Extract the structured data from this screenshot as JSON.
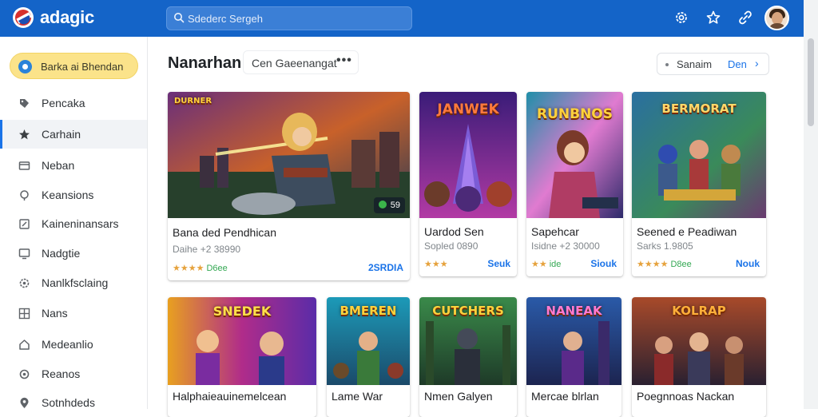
{
  "app": {
    "title": "adagic"
  },
  "search": {
    "placeholder": "Sdederc Sergeh"
  },
  "header_icons": [
    "settings-cog-icon",
    "star-icon",
    "link-icon"
  ],
  "sidebar": {
    "primary_button": "Barka ai Bhendan",
    "items": [
      {
        "label": "Pencaka",
        "icon": "tag-icon"
      },
      {
        "label": "Carhain",
        "icon": "star-icon"
      },
      {
        "label": "Neban",
        "icon": "card-icon"
      },
      {
        "label": "Keansions",
        "icon": "pin-icon"
      },
      {
        "label": "Kaineninansars",
        "icon": "edit-icon"
      },
      {
        "label": "Nadgtie",
        "icon": "monitor-icon"
      },
      {
        "label": "Nanlkfsclaing",
        "icon": "settings-icon"
      },
      {
        "label": "Nans",
        "icon": "grid-icon"
      },
      {
        "label": "Medeanlio",
        "icon": "home-icon"
      },
      {
        "label": "Reanos",
        "icon": "circle-icon"
      },
      {
        "label": "Sotnhdeds",
        "icon": "location-icon"
      }
    ]
  },
  "main": {
    "title": "Nanarhan",
    "filter": {
      "label": "Cen Gaeenangat",
      "more": "•••"
    },
    "sort": {
      "label": "Sanaim",
      "value": "Den",
      "chevron": "›"
    }
  },
  "cards_row1": [
    {
      "title": "Bana ded Pendhican",
      "sub": "Daihe +2 38990",
      "rating": "★★★★",
      "rating_text": "D6ee",
      "price": "2SRDIA",
      "badge": "59",
      "art_label": "DURNER"
    },
    {
      "title": "Uardod Sen",
      "sub": "Sopled 0890",
      "rating": "★★★",
      "rating_text": "",
      "price": "Seuk",
      "badge": "",
      "art_label": "JANWEK"
    },
    {
      "title": "Sapehcar",
      "sub": "Isidne +2 30000",
      "rating": "★★",
      "rating_text": "ide",
      "price": "Siouk",
      "badge": "",
      "art_label": "RUNBNOS"
    },
    {
      "title": "Seened e Peadiwan",
      "sub": "Sarks 1.9805",
      "rating": "★★★★",
      "rating_text": "D8ee",
      "price": "Nouk",
      "badge": "",
      "art_label": "BERMORAT"
    }
  ],
  "cards_row2": [
    {
      "title": "Halphaieauinemelcean",
      "art_label": "SNEDEK"
    },
    {
      "title": "Lame War",
      "art_label": "BMEREN"
    },
    {
      "title": "Nmen Galyen",
      "art_label": "CUTCHERS"
    },
    {
      "title": "Mercae blrlan",
      "art_label": "NANEAK"
    },
    {
      "title": "Poegnnoas Nackan",
      "art_label": "KOLRAP"
    }
  ],
  "colors": {
    "topbar": "#1464c8",
    "accent": "#1a73e8",
    "primary_button": "#fbe38a",
    "star": "#e6a23c"
  }
}
